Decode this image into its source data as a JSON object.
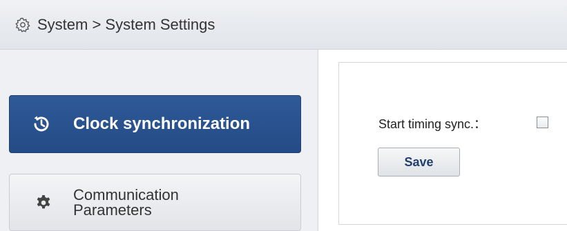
{
  "header": {
    "icon": "gear-outline-icon",
    "breadcrumb": "System > System Settings"
  },
  "sidebar": {
    "items": [
      {
        "label": "Clock synchronization",
        "icon": "history-clock-icon",
        "active": true
      },
      {
        "label": "Communication Parameters",
        "icon": "gear-icon",
        "active": false
      }
    ]
  },
  "form": {
    "start_timing_sync_label": "Start timing sync.：",
    "start_timing_sync_checked": false,
    "save_label": "Save"
  },
  "colors": {
    "accent": "#2e5a98",
    "button_text": "#1f3f6e"
  }
}
